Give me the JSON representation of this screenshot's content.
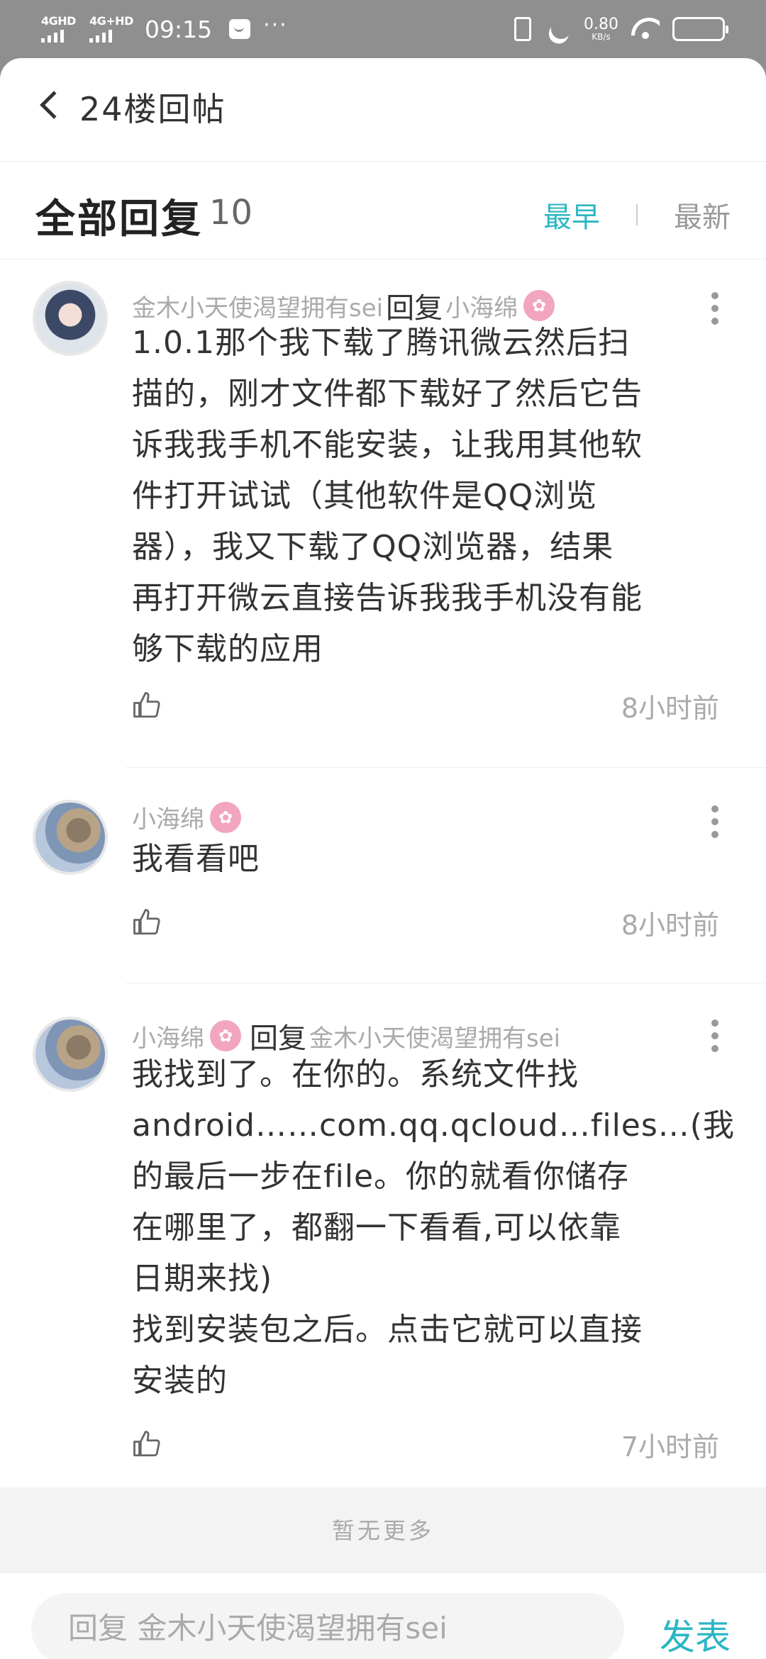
{
  "status_bar": {
    "signal1": "4GHD",
    "signal2": "4G+HD",
    "time": "09:15",
    "net_speed": "0.80",
    "net_unit": "KB/s"
  },
  "topbar": {
    "title": "24楼回帖"
  },
  "header": {
    "title": "全部回复",
    "count": "10",
    "sort_earliest": "最早",
    "sort_newest": "最新"
  },
  "replies": [
    {
      "user": "金木小天使渴望拥有sei",
      "verb": "回复",
      "target": "小海绵",
      "lines": [
        "1.0.1那个我下载了腾讯微云然后扫",
        "描的，刚才文件都下载好了然后它告",
        "诉我我手机不能安装，让我用其他软",
        "件打开试试（其他软件是QQ浏览",
        "器），我又下载了QQ浏览器，结果",
        "再打开微云直接告诉我我手机没有能",
        "够下载的应用"
      ],
      "time": "8小时前"
    },
    {
      "user": "小海绵",
      "lines": [
        "我看看吧"
      ],
      "time": "8小时前"
    },
    {
      "user": "小海绵",
      "verb": "回复",
      "target": "金木小天使渴望拥有sei",
      "lines": [
        "我找到了。在你的。系统文件找",
        "android……com.qq.qcloud…files…(我",
        "的最后一步在file。你的就看你储存",
        "在哪里了，都翻一下看看,可以依靠",
        "日期来找)",
        "找到安装包之后。点击它就可以直接",
        "安装的"
      ],
      "time": "7小时前"
    }
  ],
  "footer_note": "暂无更多",
  "bottom": {
    "input_placeholder": "回复 金木小天使渴望拥有sei",
    "send_label": "发表"
  },
  "colors": {
    "accent": "#2bb6c4",
    "badge": "#f2a5bf"
  },
  "icons": [
    "back-icon",
    "more-icon",
    "like-icon",
    "wifi-icon",
    "battery-icon",
    "moon-icon",
    "vibrate-icon"
  ]
}
